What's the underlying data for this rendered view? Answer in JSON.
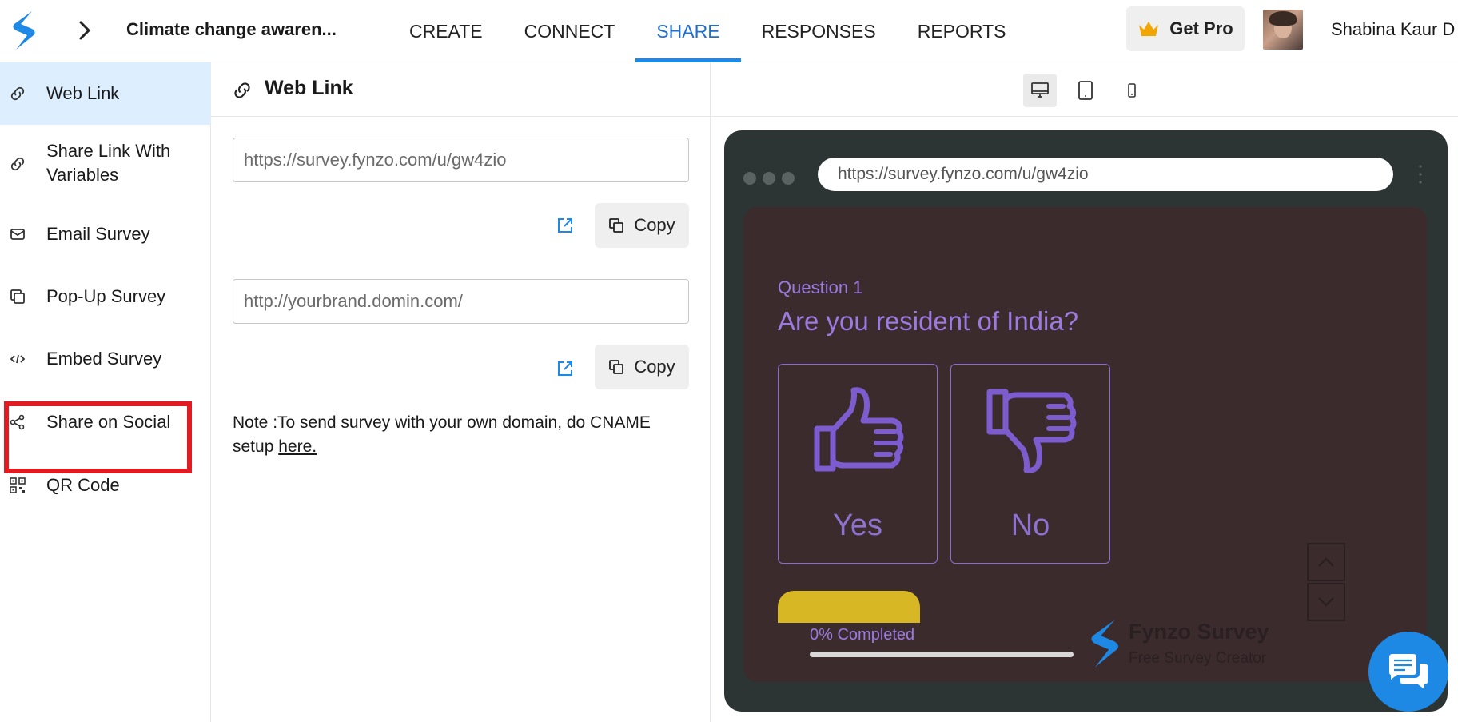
{
  "app": {
    "survey_title": "Climate change awaren...",
    "user_name": "Shabina Kaur D",
    "get_pro_label": "Get Pro",
    "brand_color": "#1e88e5"
  },
  "nav": {
    "tabs": [
      {
        "label": "CREATE",
        "active": false
      },
      {
        "label": "CONNECT",
        "active": false
      },
      {
        "label": "SHARE",
        "active": true
      },
      {
        "label": "RESPONSES",
        "active": false
      },
      {
        "label": "REPORTS",
        "active": false
      }
    ]
  },
  "sidebar": {
    "items": [
      {
        "label": "Web Link",
        "icon": "link-icon",
        "active": true
      },
      {
        "label": "Share Link With Variables",
        "icon": "link-icon",
        "active": false
      },
      {
        "label": "Email Survey",
        "icon": "mail-icon",
        "active": false
      },
      {
        "label": "Pop-Up Survey",
        "icon": "popup-icon",
        "active": false
      },
      {
        "label": "Embed Survey",
        "icon": "code-icon",
        "active": false
      },
      {
        "label": "Share on Social",
        "icon": "share-icon",
        "active": false,
        "highlighted": true
      },
      {
        "label": "QR Code",
        "icon": "qr-code-icon",
        "active": false
      }
    ],
    "highlight_color": "#e01b22"
  },
  "web_link": {
    "title": "Web Link",
    "survey_url": "https://survey.fynzo.com/u/gw4zio",
    "custom_domain_placeholder": "http://yourbrand.domin.com/",
    "copy_label": "Copy",
    "note_text": "Note :To send survey with your own domain, do CNAME setup ",
    "note_link": "here."
  },
  "preview": {
    "devices": [
      "desktop-icon",
      "tablet-icon",
      "mobile-icon"
    ],
    "active_device": "desktop-icon",
    "browser_url": "https://survey.fynzo.com/u/gw4zio",
    "question_number": "Question 1",
    "question_text": "Are you resident of India?",
    "choices": [
      {
        "label": "Yes",
        "icon": "thumbs-up-icon"
      },
      {
        "label": "No",
        "icon": "thumbs-down-icon"
      }
    ],
    "progress_label": "0% Completed",
    "progress_fraction": 0,
    "brand_name": "Fynzo Survey",
    "brand_tagline": "Free Survey Creator",
    "accent_color": "#9c7ae0",
    "screen_color": "#3c2b2d"
  }
}
